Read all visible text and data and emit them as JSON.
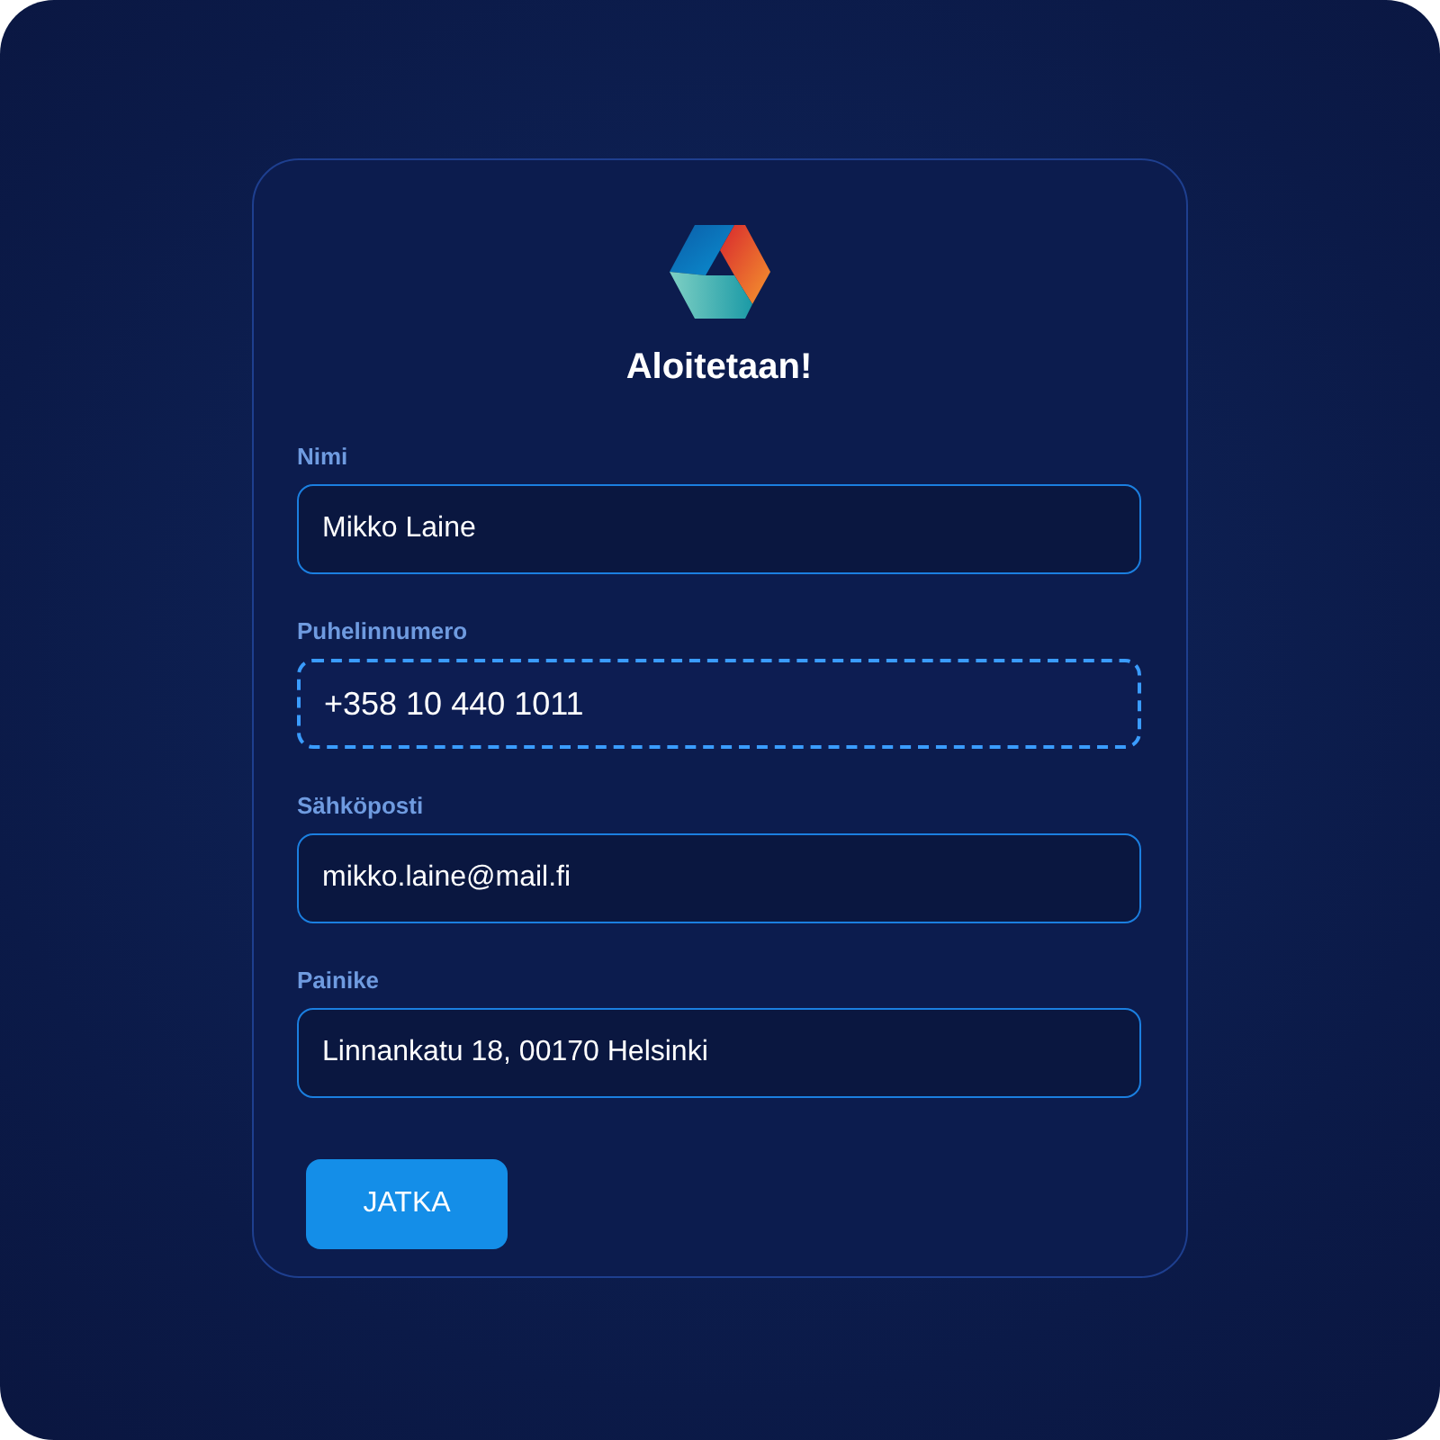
{
  "title": "Aloitetaan!",
  "fields": [
    {
      "label": "Nimi",
      "value": "Mikko Laine",
      "focused": false
    },
    {
      "label": "Puhelinnumero",
      "value": "+358 10 440 1011",
      "focused": true
    },
    {
      "label": "Sähköposti",
      "value": "mikko.laine@mail.fi",
      "focused": false
    },
    {
      "label": "Painike",
      "value": "Linnankatu 18, 00170 Helsinki",
      "focused": false
    }
  ],
  "button": "JATKA"
}
